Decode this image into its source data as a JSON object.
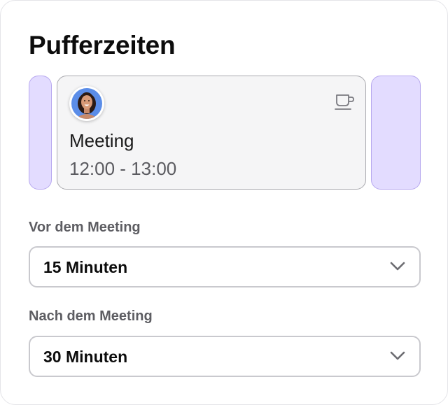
{
  "title": "Pufferzeiten",
  "event": {
    "title": "Meeting",
    "time": "12:00 - 13:00",
    "avatar_icon": "person-avatar",
    "type_icon": "coffee-cup-icon"
  },
  "before": {
    "label": "Vor dem Meeting",
    "value": "15 Minuten",
    "icon": "chevron-down-icon"
  },
  "after": {
    "label": "Nach dem Meeting",
    "value": "30 Minuten",
    "icon": "chevron-down-icon"
  },
  "colors": {
    "buffer": "#e3dcff",
    "buffer_border": "#b7a8ef",
    "event_bg": "#f5f5f6",
    "avatar_bg": "#5b8de8"
  }
}
